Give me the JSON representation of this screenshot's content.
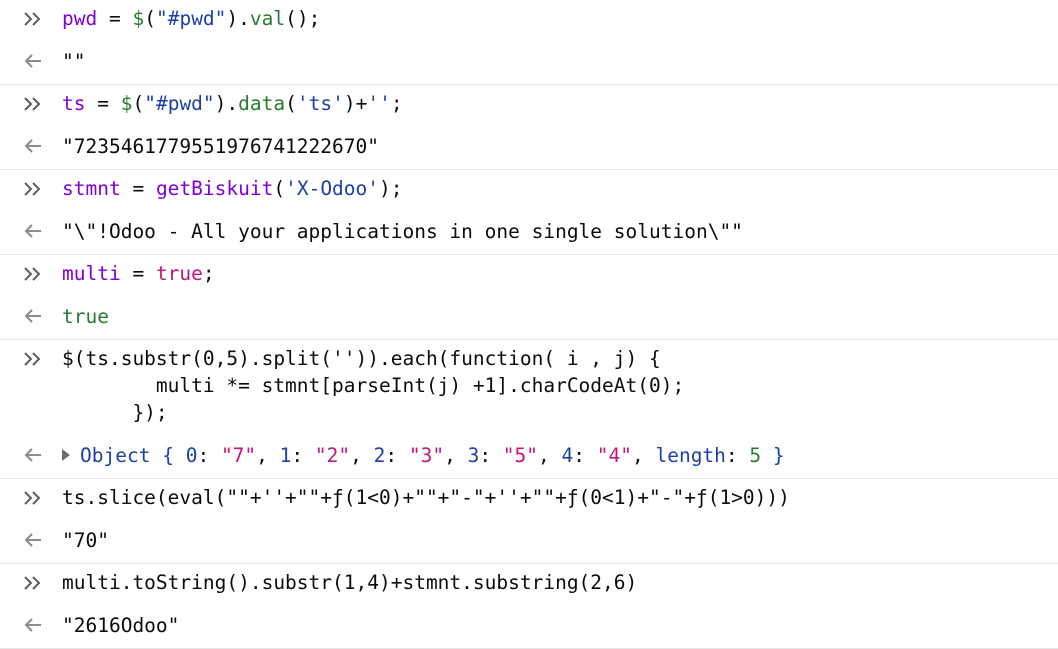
{
  "entries": [
    {
      "input": [
        "pwd",
        " = ",
        "$",
        "(",
        "\"#pwd\"",
        ")",
        ".",
        "val",
        "();"
      ],
      "output": "\"\""
    },
    {
      "input": [
        "ts",
        " = ",
        "$",
        "(",
        "\"#pwd\"",
        ")",
        ".",
        "data",
        "(",
        "'ts'",
        ")+",
        "''",
        ";"
      ],
      "output": "\"7235461779551976741222670\""
    },
    {
      "input": [
        "stmnt",
        " = ",
        "getBiskuit",
        "(",
        "'X-Odoo'",
        ");"
      ],
      "output": "\"\\\"!Odoo - All your applications in one single solution\\\"\""
    },
    {
      "input": [
        "multi",
        " = ",
        "true",
        ";"
      ],
      "output": "true"
    },
    {
      "input_lines": [
        "$(ts.substr(0,5).split('')).each(function( i , j) {",
        "        multi *= stmnt[parseInt(j) +1].charCodeAt(0);",
        "      });"
      ],
      "output_preview": {
        "label": "Object",
        "open": "{",
        "items": [
          {
            "key": "0",
            "value": "\"7\""
          },
          {
            "key": "1",
            "value": "\"2\""
          },
          {
            "key": "2",
            "value": "\"3\""
          },
          {
            "key": "3",
            "value": "\"5\""
          },
          {
            "key": "4",
            "value": "\"4\""
          }
        ],
        "length_key": "length",
        "length_value": "5",
        "close": "}"
      }
    },
    {
      "input_text": "ts.slice(eval(\"\"+''+\"\"+ƒ(1<0)+\"\"+\"-\"+''+\"\"+ƒ(0<1)+\"-\"+ƒ(1>0)))",
      "output": "\"70\""
    },
    {
      "input_text": "multi.toString().substr(1,4)+stmnt.substring(2,6)",
      "output": "\"2616Odoo\""
    }
  ]
}
